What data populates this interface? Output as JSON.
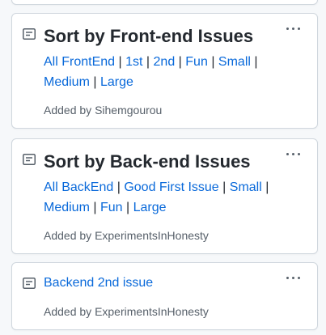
{
  "cards": [
    {
      "title": "Sort by Front-end Issues",
      "links": [
        "All FrontEnd",
        "1st",
        "2nd",
        "Fun",
        "Small",
        "Medium",
        "Large"
      ],
      "added_by_prefix": "Added by",
      "added_by_user": "Sihemgourou"
    },
    {
      "title": "Sort by Back-end Issues",
      "links": [
        "All BackEnd",
        "Good First Issue",
        "Small",
        "Medium",
        "Fun",
        "Large"
      ],
      "added_by_prefix": "Added by",
      "added_by_user": "ExperimentsInHonesty"
    },
    {
      "title": "Backend 2nd issue",
      "added_by_prefix": "Added by",
      "added_by_user": "ExperimentsInHonesty"
    }
  ],
  "separator": "|",
  "icons": {
    "card_icon": "note-icon",
    "menu_icon": "kebab-horizontal-icon"
  },
  "colors": {
    "link": "#0969da",
    "text": "#24292f",
    "muted": "#57606a",
    "border": "#d0d7de",
    "background": "#f6f8fa"
  }
}
